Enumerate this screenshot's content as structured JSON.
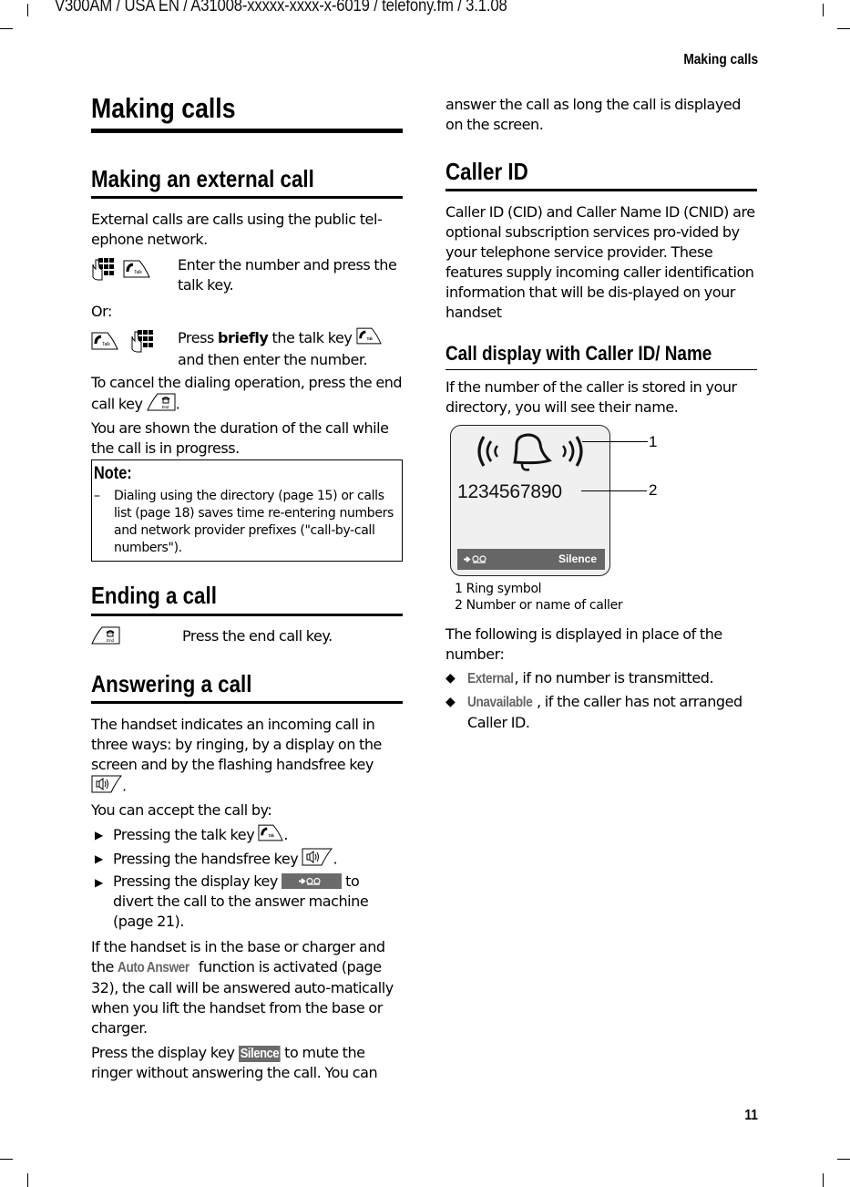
{
  "header": {
    "doc_meta": "V300AM / USA EN / A31008-xxxxx-xxxx-x-6019 / telefony.fm / 3.1.08",
    "running_head": "Making calls",
    "page_number": "11"
  },
  "left": {
    "title": "Making calls",
    "external": {
      "heading": "Making an external call",
      "intro": "External calls are calls using the public tel-ephone network.",
      "step1_text": "Enter the number and press the talk key.",
      "or_label": "Or:",
      "step2_pre": "Press ",
      "step2_bold": "briefly",
      "step2_post": " the talk key",
      "step2_tail": "and then enter the number.",
      "cancel_pre": "To cancel the dialing operation, press the end call key",
      "cancel_post": ".",
      "duration": "You are shown the duration of the call while the call is in progress.",
      "note_title": "Note:",
      "note_dash": "–",
      "note_text": "Dialing using the directory (page 15) or calls list (page 18) saves time re-entering numbers and network provider prefixes (\"call-by-call numbers\")."
    },
    "ending": {
      "heading": "Ending a call",
      "step_text": "Press the end call key."
    },
    "answering": {
      "heading": "Answering a call",
      "intro_pre": "The handset indicates an incoming call in three ways: by ringing, by a display on the screen and by the flashing handsfree key",
      "intro_post": ".",
      "accept_label": "You can accept the call by:",
      "options": [
        {
          "pre": "Pressing the talk key",
          "post": "."
        },
        {
          "pre": "Pressing the handsfree key",
          "post": "."
        },
        {
          "pre": "Pressing the display key",
          "post": " to divert the call to the answer machine (page 21)."
        }
      ],
      "auto_pre": "If the handset is in the base or charger and the ",
      "auto_term": "Auto Answer",
      "auto_post": " function is activated (page 32), the call will be answered auto-matically when you lift the handset from the base or charger.",
      "silence_pre": "Press the display key ",
      "silence_key": "Silence",
      "silence_post": " to mute the ringer without answering the call. You can"
    }
  },
  "right": {
    "continuation": "answer the call as long the call is displayed on the screen.",
    "caller_id": {
      "heading": "Caller ID",
      "intro": "Caller ID (CID) and Caller Name ID (CNID) are optional subscription services pro-vided by your telephone service provider. These features supply incoming caller identification information that will be dis-played on your handset"
    },
    "call_display": {
      "heading": "Call display with Caller ID/ Name",
      "intro": "If the number of the caller is stored in your directory, you will see their name.",
      "screen": {
        "number": "1234567890",
        "left_softkey_icon": "divert-to-answering-machine-icon",
        "right_softkey": "Silence"
      },
      "callouts": [
        "1",
        "2"
      ],
      "legend": [
        {
          "num": "1",
          "text": "Ring symbol"
        },
        {
          "num": "2",
          "text": "Number or name of caller"
        }
      ],
      "following": "The following is displayed in place of the number:",
      "items": [
        {
          "term": "External",
          "text": ", if no number is transmitted."
        },
        {
          "term": "Unavailable",
          "text": ", if the caller has not arranged Caller ID."
        }
      ]
    }
  }
}
